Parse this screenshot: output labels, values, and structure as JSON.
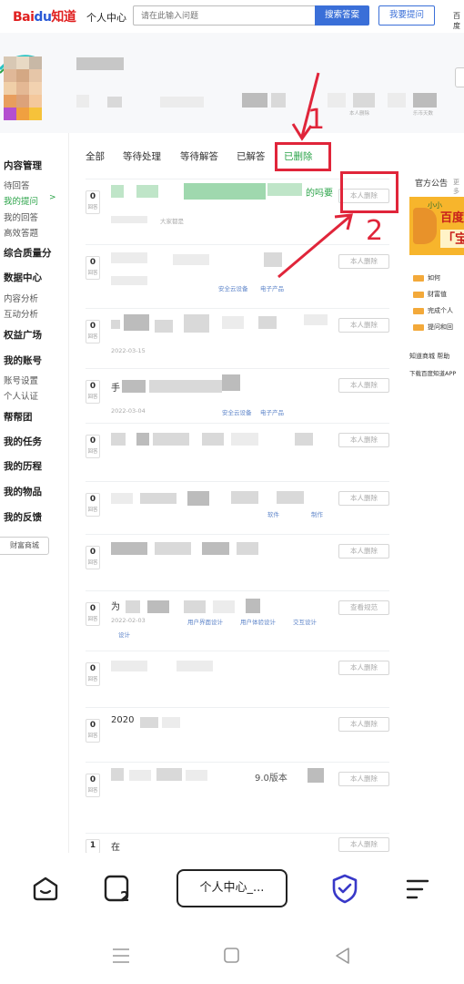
{
  "topbar": {
    "logo_bai": "Bai",
    "logo_du": "du",
    "logo_zhidao": "知道",
    "nav_center": "个人中心",
    "search_placeholder": "请在此输入问题",
    "search_button": "搜索答案",
    "ask_button": "我要提问",
    "more": "百度"
  },
  "profile": {
    "blurred_fields": [
      "0",
      "0"
    ],
    "small_labels": [
      "本人删除",
      "乐币天数"
    ]
  },
  "sidebar": {
    "groups": [
      {
        "title": "内容管理",
        "items": [
          "待回答",
          "我的提问",
          "我的回答",
          "高效答题"
        ]
      },
      {
        "title": "综合质量分",
        "items": []
      },
      {
        "title": "数据中心",
        "items": [
          "内容分析",
          "互动分析"
        ]
      },
      {
        "title": "权益广场",
        "items": []
      },
      {
        "title": "我的账号",
        "items": [
          "账号设置",
          "个人认证"
        ]
      },
      {
        "title": "帮帮团",
        "items": []
      },
      {
        "title": "我的任务",
        "items": []
      },
      {
        "title": "我的历程",
        "items": []
      },
      {
        "title": "我的物品",
        "items": []
      },
      {
        "title": "我的反馈",
        "items": []
      }
    ],
    "active_item": "我的提问",
    "active_arrow": ">",
    "mall_button": "财富商城"
  },
  "main": {
    "tabs": [
      "全部",
      "等待处理",
      "等待解答",
      "已解答",
      "已删除"
    ],
    "active_tab": "已删除",
    "rows": [
      {
        "count": "0",
        "unit": "回答",
        "text": "的吗要",
        "meta": "大家都是",
        "button": "本人删除"
      },
      {
        "count": "0",
        "unit": "回答",
        "text": "",
        "meta": "",
        "meta2": "安全云设备",
        "meta3": "电子产品",
        "button": "本人删除"
      },
      {
        "count": "0",
        "unit": "回答",
        "text": "",
        "meta": "2022-03-15",
        "button": "本人删除"
      },
      {
        "count": "0",
        "unit": "回答",
        "text": "手",
        "meta": "2022-03-04",
        "meta2": "安全云设备",
        "meta3": "电子产品",
        "button": "本人删除"
      },
      {
        "count": "0",
        "unit": "回答",
        "text": "",
        "meta": "",
        "button": "本人删除"
      },
      {
        "count": "0",
        "unit": "回答",
        "text": "",
        "meta": "",
        "meta2": "软件",
        "meta3": "制作",
        "button": "本人删除"
      },
      {
        "count": "0",
        "unit": "回答",
        "text": "",
        "meta": "",
        "button": "本人删除"
      },
      {
        "count": "0",
        "unit": "回答",
        "text": "为",
        "meta": "2022-02-03",
        "meta2": "用户界面设计",
        "meta3": "用户体验设计",
        "meta4": "交互设计",
        "meta5": "设计",
        "button": "查看规范"
      },
      {
        "count": "0",
        "unit": "回答",
        "text": "",
        "meta": "",
        "button": "本人删除"
      },
      {
        "count": "0",
        "unit": "回答",
        "text": "2020",
        "meta": "",
        "button": "本人删除"
      },
      {
        "count": "0",
        "unit": "回答",
        "text": "",
        "meta": "",
        "mid_text": "9.0版本",
        "button": "本人删除"
      },
      {
        "count": "1",
        "unit": "回答",
        "text": "在",
        "meta": "",
        "button": "本人删除"
      }
    ]
  },
  "right": {
    "title": "官方公告",
    "more": "更多",
    "banner_line1": "小小",
    "banner_line2": "百度",
    "banner_line3": "「宝",
    "items": [
      "如何",
      "财富值",
      "完成个人",
      "提问和回"
    ],
    "links": "知道商城  帮助",
    "download": "下载百度知道APP"
  },
  "annotations": {
    "label1": "1",
    "label2": "2"
  },
  "bottom_nav": {
    "address": "个人中心_..."
  },
  "colors": {
    "brand_red": "#e02020",
    "brand_blue": "#3a6fd8",
    "accent_green": "#2aa348",
    "annotation_red": "#e0253a"
  }
}
